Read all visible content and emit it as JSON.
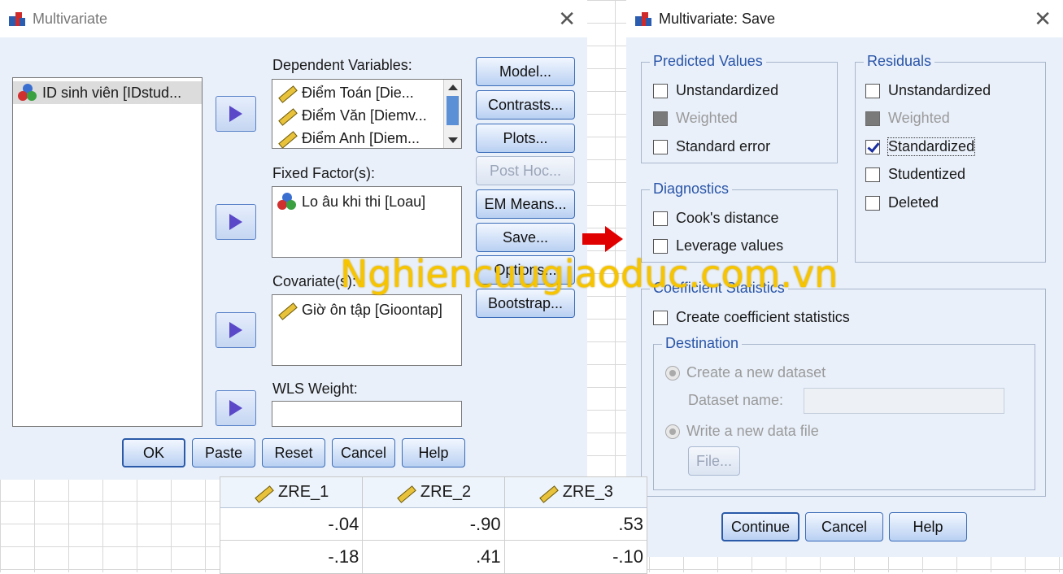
{
  "multivariate": {
    "title": "Multivariate",
    "source_list": [
      "ID sinh viên [IDstud..."
    ],
    "dependent_label": "Dependent Variables:",
    "dependent_items": [
      "Điểm Toán [Die...",
      "Điểm Văn [Diemv...",
      "Điểm Anh [Diem..."
    ],
    "fixed_label": "Fixed Factor(s):",
    "fixed_items": [
      "Lo âu khi thi [Loau]"
    ],
    "covariate_label": "Covariate(s):",
    "covariate_items": [
      "Giờ ôn tập [Gioontap]"
    ],
    "wls_label": "WLS Weight:",
    "wls_value": "",
    "side_buttons": {
      "model": "Model...",
      "contrasts": "Contrasts...",
      "plots": "Plots...",
      "posthoc": "Post Hoc...",
      "emmeans": "EM Means...",
      "save": "Save...",
      "options": "Options...",
      "bootstrap": "Bootstrap..."
    },
    "bottom_buttons": {
      "ok": "OK",
      "paste": "Paste",
      "reset": "Reset",
      "cancel": "Cancel",
      "help": "Help"
    }
  },
  "save_dialog": {
    "title": "Multivariate: Save",
    "predicted": {
      "legend": "Predicted Values",
      "unstandardized": "Unstandardized",
      "weighted": "Weighted",
      "standard_error": "Standard error"
    },
    "residuals": {
      "legend": "Residuals",
      "unstandardized": "Unstandardized",
      "weighted": "Weighted",
      "standardized": "Standardized",
      "studentized": "Studentized",
      "deleted": "Deleted"
    },
    "diagnostics": {
      "legend": "Diagnostics",
      "cooks": "Cook's distance",
      "leverage": "Leverage values"
    },
    "coef": {
      "legend": "Coefficient Statistics",
      "create": "Create coefficient statistics",
      "destination_legend": "Destination",
      "new_dataset": "Create a new dataset",
      "dataset_name_label": "Dataset name:",
      "write_file": "Write a new data file",
      "file_button": "File..."
    },
    "buttons": {
      "continue": "Continue",
      "cancel": "Cancel",
      "help": "Help"
    }
  },
  "data_table": {
    "headers": [
      "ZRE_1",
      "ZRE_2",
      "ZRE_3"
    ],
    "rows": [
      [
        "-.04",
        "-.90",
        ".53"
      ],
      [
        "-.18",
        ".41",
        "-.10"
      ]
    ]
  },
  "watermark": "Nghiencuugiaoduc.com.vn",
  "colors": {
    "accent": "#2a55a8",
    "arrow": "#e00000",
    "watermark": "#f6c400"
  }
}
